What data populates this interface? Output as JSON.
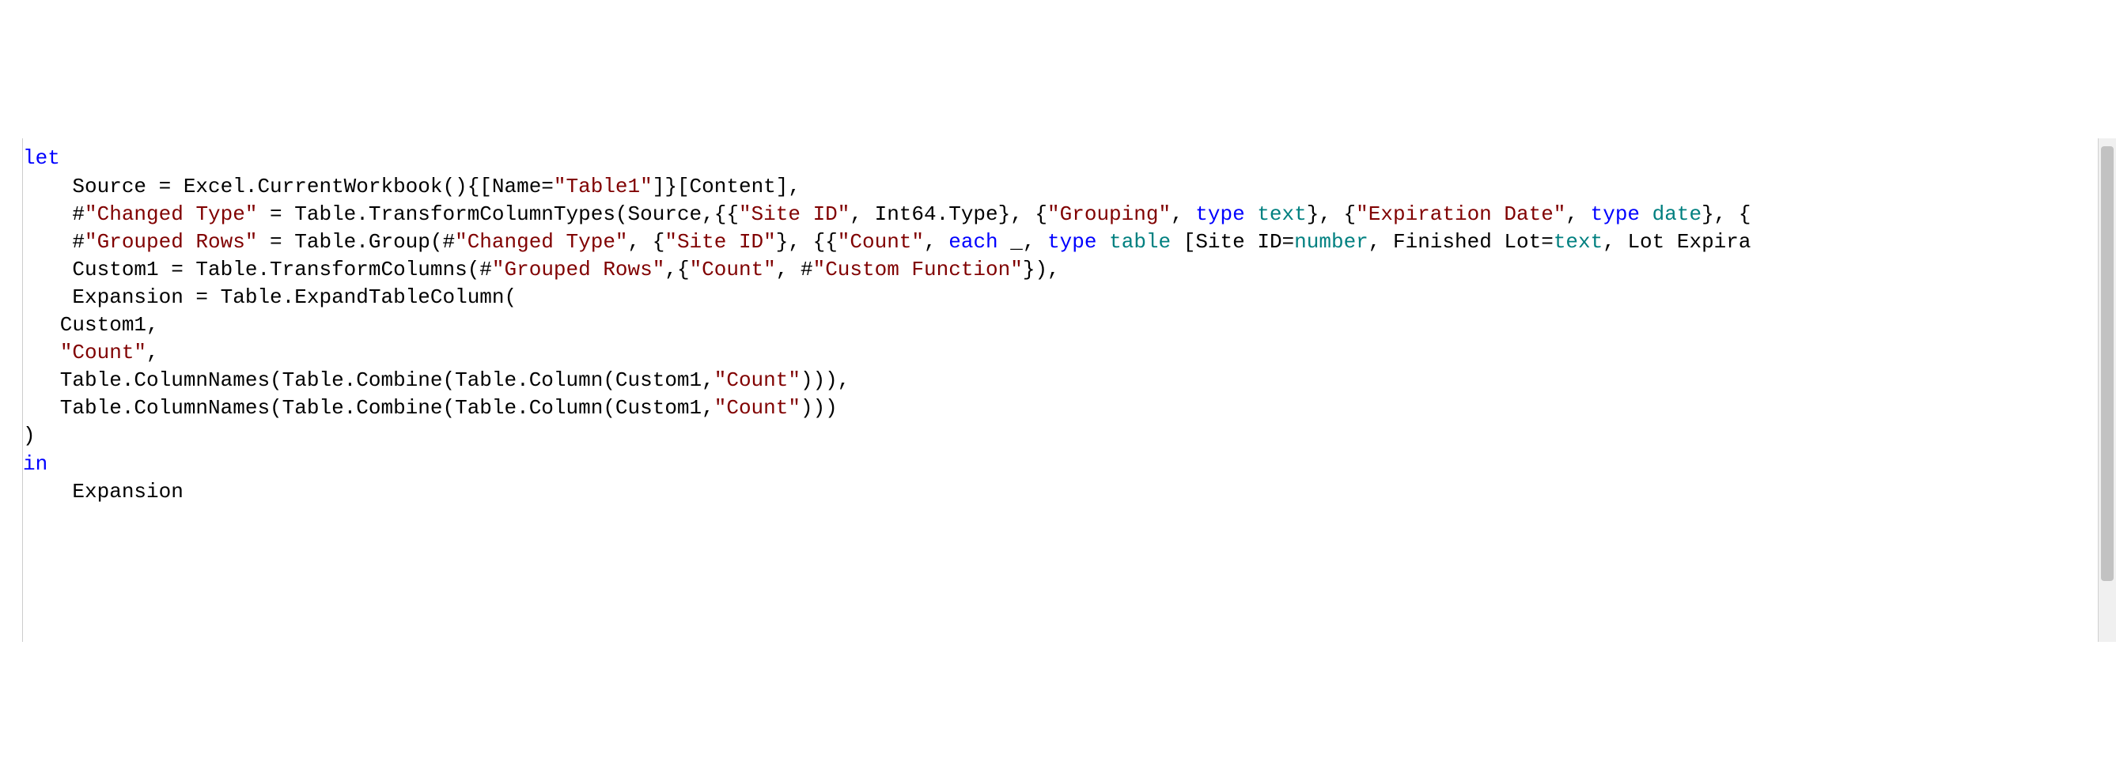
{
  "code": {
    "lines": [
      [
        {
          "cls": "tok-kw",
          "t": "let"
        }
      ],
      [
        {
          "cls": "",
          "t": "    Source = Excel.CurrentWorkbook(){[Name="
        },
        {
          "cls": "tok-str",
          "t": "\"Table1\""
        },
        {
          "cls": "",
          "t": "]}[Content],"
        }
      ],
      [
        {
          "cls": "",
          "t": "    #"
        },
        {
          "cls": "tok-str",
          "t": "\"Changed Type\""
        },
        {
          "cls": "",
          "t": " = Table.TransformColumnTypes(Source,{{"
        },
        {
          "cls": "tok-str",
          "t": "\"Site ID\""
        },
        {
          "cls": "",
          "t": ", Int64.Type}, {"
        },
        {
          "cls": "tok-str",
          "t": "\"Grouping\""
        },
        {
          "cls": "",
          "t": ", "
        },
        {
          "cls": "tok-kw",
          "t": "type"
        },
        {
          "cls": "",
          "t": " "
        },
        {
          "cls": "tok-typ",
          "t": "text"
        },
        {
          "cls": "",
          "t": "}, {"
        },
        {
          "cls": "tok-str",
          "t": "\"Expiration Date\""
        },
        {
          "cls": "",
          "t": ", "
        },
        {
          "cls": "tok-kw",
          "t": "type"
        },
        {
          "cls": "",
          "t": " "
        },
        {
          "cls": "tok-typ",
          "t": "date"
        },
        {
          "cls": "",
          "t": "}, {"
        }
      ],
      [
        {
          "cls": "",
          "t": "    #"
        },
        {
          "cls": "tok-str",
          "t": "\"Grouped Rows\""
        },
        {
          "cls": "",
          "t": " = Table.Group(#"
        },
        {
          "cls": "tok-str",
          "t": "\"Changed Type\""
        },
        {
          "cls": "",
          "t": ", {"
        },
        {
          "cls": "tok-str",
          "t": "\"Site ID\""
        },
        {
          "cls": "",
          "t": "}, {{"
        },
        {
          "cls": "tok-str",
          "t": "\"Count\""
        },
        {
          "cls": "",
          "t": ", "
        },
        {
          "cls": "tok-kw",
          "t": "each"
        },
        {
          "cls": "",
          "t": " _, "
        },
        {
          "cls": "tok-kw",
          "t": "type"
        },
        {
          "cls": "",
          "t": " "
        },
        {
          "cls": "tok-typ",
          "t": "table"
        },
        {
          "cls": "",
          "t": " [Site ID="
        },
        {
          "cls": "tok-typ",
          "t": "number"
        },
        {
          "cls": "",
          "t": ", Finished Lot="
        },
        {
          "cls": "tok-typ",
          "t": "text"
        },
        {
          "cls": "",
          "t": ", Lot Expira"
        }
      ],
      [
        {
          "cls": "",
          "t": "    Custom1 = Table.TransformColumns(#"
        },
        {
          "cls": "tok-str",
          "t": "\"Grouped Rows\""
        },
        {
          "cls": "",
          "t": ",{"
        },
        {
          "cls": "tok-str",
          "t": "\"Count\""
        },
        {
          "cls": "",
          "t": ", #"
        },
        {
          "cls": "tok-str",
          "t": "\"Custom Function\""
        },
        {
          "cls": "",
          "t": "}),"
        }
      ],
      [
        {
          "cls": "",
          "t": "    Expansion = Table.ExpandTableColumn("
        }
      ],
      [
        {
          "cls": "",
          "t": "   Custom1,"
        }
      ],
      [
        {
          "cls": "",
          "t": "   "
        },
        {
          "cls": "tok-str",
          "t": "\"Count\""
        },
        {
          "cls": "",
          "t": ","
        }
      ],
      [
        {
          "cls": "",
          "t": "   Table.ColumnNames(Table.Combine(Table.Column(Custom1,"
        },
        {
          "cls": "tok-str",
          "t": "\"Count\""
        },
        {
          "cls": "",
          "t": "))),"
        }
      ],
      [
        {
          "cls": "",
          "t": "   Table.ColumnNames(Table.Combine(Table.Column(Custom1,"
        },
        {
          "cls": "tok-str",
          "t": "\"Count\""
        },
        {
          "cls": "",
          "t": ")))"
        }
      ],
      [
        {
          "cls": "",
          "t": ")"
        }
      ],
      [
        {
          "cls": "tok-kw",
          "t": "in"
        }
      ],
      [
        {
          "cls": "",
          "t": "    Expansion"
        }
      ]
    ]
  }
}
